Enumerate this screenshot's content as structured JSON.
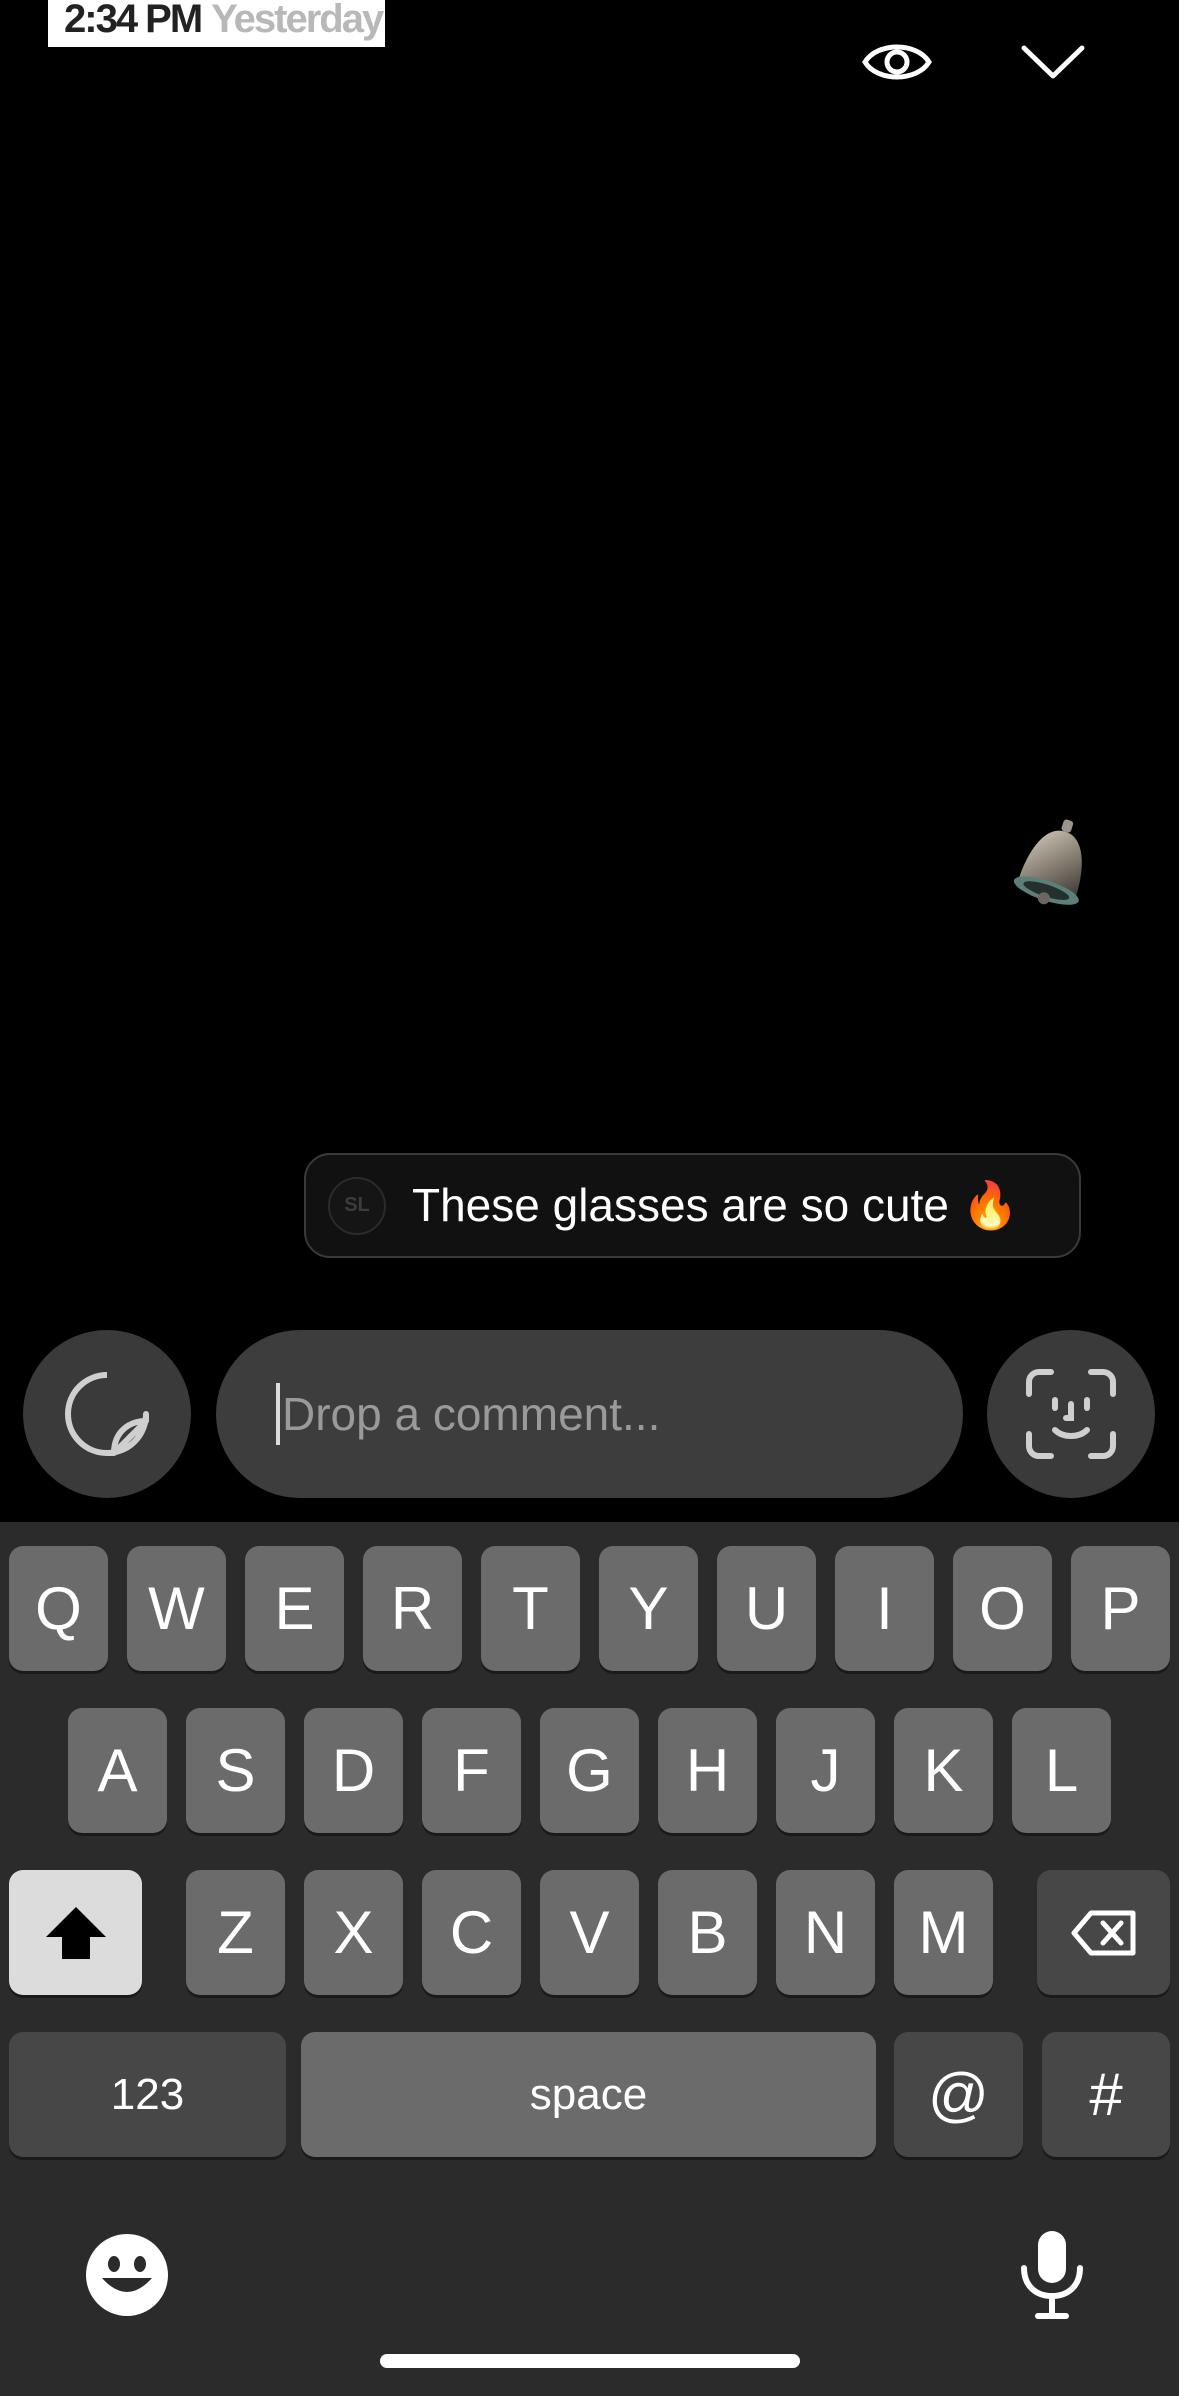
{
  "story": {
    "timestamp_time": "2:34 PM",
    "timestamp_day": "Yesterday",
    "icons": {
      "eye": "eye-icon",
      "collapse": "chevron-down-icon",
      "sticker": "bell-sticker"
    }
  },
  "comment": {
    "avatar_initials": "SL",
    "text": "These glasses are so cute 🔥"
  },
  "composer": {
    "placeholder": "Drop a comment...",
    "value": ""
  },
  "keyboard": {
    "row1": [
      "Q",
      "W",
      "E",
      "R",
      "T",
      "Y",
      "U",
      "I",
      "O",
      "P"
    ],
    "row2": [
      "A",
      "S",
      "D",
      "F",
      "G",
      "H",
      "J",
      "K",
      "L"
    ],
    "row3": [
      "Z",
      "X",
      "C",
      "V",
      "B",
      "N",
      "M"
    ],
    "numbers_label": "123",
    "space_label": "space",
    "at_label": "@",
    "hash_label": "#"
  }
}
